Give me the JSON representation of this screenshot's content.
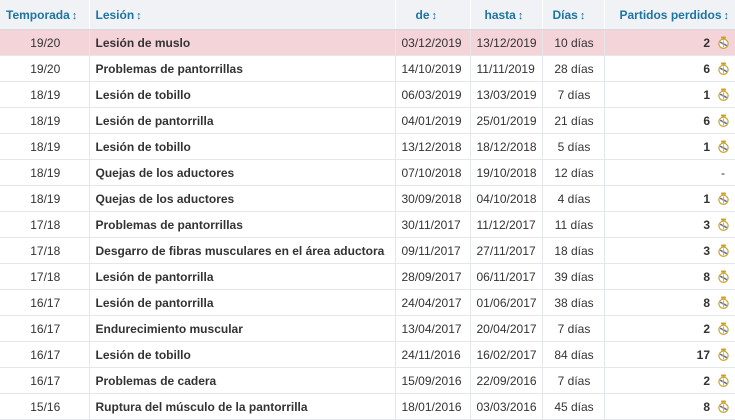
{
  "header": {
    "season": "Temporada",
    "injury": "Lesión",
    "from": "de",
    "until": "hasta",
    "days": "Días",
    "games_missed": "Partidos perdidos",
    "sort_arrow": "↕"
  },
  "rows": [
    {
      "season": "19/20",
      "injury": "Lesión de muslo",
      "from": "03/12/2019",
      "until": "13/12/2019",
      "days": "10 días",
      "games": "2",
      "club_icon": "real-madrid-crest",
      "highlight": true
    },
    {
      "season": "19/20",
      "injury": "Problemas de pantorrillas",
      "from": "14/10/2019",
      "until": "11/11/2019",
      "days": "28 días",
      "games": "6",
      "club_icon": "real-madrid-crest"
    },
    {
      "season": "18/19",
      "injury": "Lesión de tobillo",
      "from": "06/03/2019",
      "until": "13/03/2019",
      "days": "7 días",
      "games": "1",
      "club_icon": "real-madrid-crest"
    },
    {
      "season": "18/19",
      "injury": "Lesión de pantorrilla",
      "from": "04/01/2019",
      "until": "25/01/2019",
      "days": "21 días",
      "games": "6",
      "club_icon": "real-madrid-crest"
    },
    {
      "season": "18/19",
      "injury": "Lesión de tobillo",
      "from": "13/12/2018",
      "until": "18/12/2018",
      "days": "5 días",
      "games": "1",
      "club_icon": "real-madrid-crest"
    },
    {
      "season": "18/19",
      "injury": "Quejas de los aductores",
      "from": "07/10/2018",
      "until": "19/10/2018",
      "days": "12 días",
      "games": "-",
      "club_icon": ""
    },
    {
      "season": "18/19",
      "injury": "Quejas de los aductores",
      "from": "30/09/2018",
      "until": "04/10/2018",
      "days": "4 días",
      "games": "1",
      "club_icon": "real-madrid-crest"
    },
    {
      "season": "17/18",
      "injury": "Problemas de pantorrillas",
      "from": "30/11/2017",
      "until": "11/12/2017",
      "days": "11 días",
      "games": "3",
      "club_icon": "real-madrid-crest"
    },
    {
      "season": "17/18",
      "injury": "Desgarro de fibras musculares en el área aductora",
      "from": "09/11/2017",
      "until": "27/11/2017",
      "days": "18 días",
      "games": "3",
      "club_icon": "real-madrid-crest"
    },
    {
      "season": "17/18",
      "injury": "Lesión de pantorrilla",
      "from": "28/09/2017",
      "until": "06/11/2017",
      "days": "39 días",
      "games": "8",
      "club_icon": "real-madrid-crest"
    },
    {
      "season": "16/17",
      "injury": "Lesión de pantorrilla",
      "from": "24/04/2017",
      "until": "01/06/2017",
      "days": "38 días",
      "games": "8",
      "club_icon": "real-madrid-crest"
    },
    {
      "season": "16/17",
      "injury": "Endurecimiento muscular",
      "from": "13/04/2017",
      "until": "20/04/2017",
      "days": "7 días",
      "games": "2",
      "club_icon": "real-madrid-crest"
    },
    {
      "season": "16/17",
      "injury": "Lesión de tobillo",
      "from": "24/11/2016",
      "until": "16/02/2017",
      "days": "84 días",
      "games": "17",
      "club_icon": "real-madrid-crest"
    },
    {
      "season": "16/17",
      "injury": "Problemas de cadera",
      "from": "15/09/2016",
      "until": "22/09/2016",
      "days": "7 días",
      "games": "2",
      "club_icon": "real-madrid-crest"
    },
    {
      "season": "15/16",
      "injury": "Ruptura del músculo de la pantorrilla",
      "from": "18/01/2016",
      "until": "03/03/2016",
      "days": "45 días",
      "games": "8",
      "club_icon": "real-madrid-crest"
    }
  ],
  "colors": {
    "header_text": "#1d75a3",
    "header_bg": "#f0f2f5",
    "highlight_row": "#f4d3d9",
    "crest_gold": "#c9a227"
  }
}
